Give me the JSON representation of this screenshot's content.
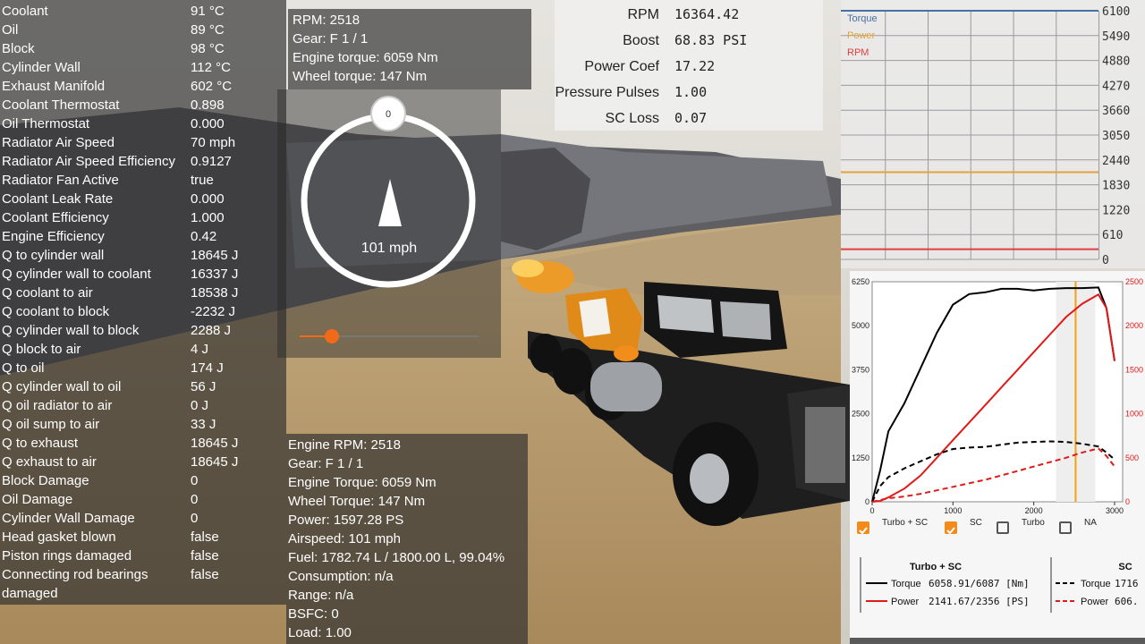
{
  "thermal": [
    {
      "label": "Coolant",
      "value": "91 °C"
    },
    {
      "label": "Oil",
      "value": "89 °C"
    },
    {
      "label": "Block",
      "value": "98 °C"
    },
    {
      "label": "Cylinder Wall",
      "value": "112 °C"
    },
    {
      "label": "Exhaust Manifold",
      "value": "602 °C"
    },
    {
      "label": "Coolant Thermostat",
      "value": "0.898"
    },
    {
      "label": "Oil Thermostat",
      "value": "0.000"
    },
    {
      "label": "Radiator Air Speed",
      "value": "70 mph"
    },
    {
      "label": "Radiator Air Speed Efficiency",
      "value": "0.9127"
    },
    {
      "label": "Radiator Fan Active",
      "value": "true"
    },
    {
      "label": "Coolant Leak Rate",
      "value": "0.000"
    },
    {
      "label": "Coolant Efficiency",
      "value": "1.000"
    },
    {
      "label": "Engine Efficiency",
      "value": "0.42"
    },
    {
      "label": "Q to cylinder wall",
      "value": "18645 J"
    },
    {
      "label": "Q cylinder wall to coolant",
      "value": "16337 J"
    },
    {
      "label": "Q coolant to air",
      "value": "18538 J"
    },
    {
      "label": "Q coolant to block",
      "value": "-2232 J"
    },
    {
      "label": "Q cylinder wall to block",
      "value": "2288 J"
    },
    {
      "label": "Q block to air",
      "value": "4 J"
    },
    {
      "label": "Q to oil",
      "value": "174 J"
    },
    {
      "label": "Q cylinder wall to oil",
      "value": "56 J"
    },
    {
      "label": "Q oil radiator to air",
      "value": "0 J"
    },
    {
      "label": "Q oil sump to air",
      "value": "33 J"
    },
    {
      "label": "Q to exhaust",
      "value": "18645 J"
    },
    {
      "label": "Q exhaust to air",
      "value": "18645 J"
    },
    {
      "label": "Block Damage",
      "value": "0"
    },
    {
      "label": "Oil Damage",
      "value": "0"
    },
    {
      "label": "Cylinder Wall Damage",
      "value": "0"
    },
    {
      "label": "Head gasket blown",
      "value": "false"
    },
    {
      "label": "Piston rings damaged",
      "value": "false"
    },
    {
      "label": "Connecting rod bearings",
      "value": "false"
    },
    {
      "label": "damaged",
      "value": ""
    }
  ],
  "top_info": {
    "rpm": "RPM: 2518",
    "gear": "Gear: F 1 / 1",
    "engine_torque": "Engine torque: 6059 Nm",
    "wheel_torque": "Wheel torque: 147 Nm"
  },
  "gauge": {
    "top_value": "0",
    "speed": "101 mph",
    "slider_fraction": 0.18
  },
  "engine_info": [
    "Engine RPM: 2518",
    "Gear: F 1 / 1",
    "Engine Torque: 6059 Nm",
    "Wheel Torque: 147 Nm",
    "Power: 1597.28 PS",
    "Airspeed: 101 mph",
    "Fuel: 1782.74 L / 1800.00 L, 99.04%",
    "Consumption: n/a",
    "Range: n/a",
    "BSFC: 0",
    "Load: 1.00"
  ],
  "engine_stats": [
    {
      "label": "RPM",
      "value": "16364.42"
    },
    {
      "label": "Boost",
      "value": "68.83 PSI"
    },
    {
      "label": "Power Coef",
      "value": "17.22"
    },
    {
      "label": "Pressure Pulses",
      "value": "1.00"
    },
    {
      "label": "SC Loss",
      "value": "0.07"
    }
  ],
  "live_graph": {
    "legend": [
      {
        "name": "Torque",
        "color": "#4a6fa5"
      },
      {
        "name": "Power",
        "color": "#e3a33a"
      },
      {
        "name": "RPM",
        "color": "#e04040"
      }
    ],
    "y_ticks": [
      "6100",
      "5490",
      "4880",
      "4270",
      "3660",
      "3050",
      "2440",
      "1830",
      "1220",
      "610",
      "0"
    ],
    "y_max": 6100,
    "series_levels": {
      "Torque": 6100,
      "Power": 2140,
      "RPM": 250
    }
  },
  "chart_data": {
    "type": "line",
    "x": [
      0,
      100,
      200,
      400,
      600,
      800,
      1000,
      1200,
      1400,
      1600,
      1800,
      2000,
      2200,
      2400,
      2600,
      2800,
      2900,
      3000
    ],
    "xlim": [
      0,
      3100
    ],
    "x_ticks": [
      "0",
      "1000",
      "2000",
      "3000"
    ],
    "y_left_ticks": [
      "0",
      "1250",
      "2500",
      "3750",
      "5000",
      "6250"
    ],
    "y_right_ticks": [
      "0",
      "500",
      "1000",
      "1500",
      "2000",
      "2500"
    ],
    "ylim_left": [
      0,
      6250
    ],
    "ylim_right": [
      0,
      2500
    ],
    "marker_rpm": 2518,
    "series": [
      {
        "name": "Torque",
        "group": "Turbo + SC",
        "axis": "left",
        "style": "solid",
        "color": "#000000",
        "values": [
          0,
          900,
          2000,
          2800,
          3800,
          4800,
          5600,
          5900,
          5950,
          6050,
          6050,
          6000,
          6050,
          6070,
          6070,
          6087,
          5500,
          4000
        ]
      },
      {
        "name": "Power",
        "group": "Turbo + SC",
        "axis": "right",
        "style": "solid",
        "color": "#e01a1a",
        "values": [
          0,
          10,
          50,
          150,
          300,
          500,
          700,
          900,
          1100,
          1300,
          1500,
          1700,
          1900,
          2100,
          2250,
          2356,
          2200,
          1600
        ]
      },
      {
        "name": "Torque",
        "group": "SC",
        "axis": "left",
        "style": "dashed",
        "color": "#000000",
        "values": [
          0,
          450,
          700,
          950,
          1150,
          1350,
          1500,
          1540,
          1560,
          1620,
          1680,
          1700,
          1716,
          1700,
          1650,
          1570,
          1400,
          1200
        ]
      },
      {
        "name": "Power",
        "group": "SC",
        "axis": "right",
        "style": "dashed",
        "color": "#e01a1a",
        "values": [
          0,
          20,
          40,
          60,
          90,
          130,
          170,
          210,
          250,
          300,
          350,
          400,
          450,
          500,
          560,
          606,
          520,
          400
        ]
      }
    ]
  },
  "dyno_checkboxes": [
    {
      "label": "Turbo + SC",
      "checked": true
    },
    {
      "label": "SC",
      "checked": true
    },
    {
      "label": "Turbo",
      "checked": false
    },
    {
      "label": "NA",
      "checked": false
    }
  ],
  "dyno_legend": {
    "group1": "Turbo + SC",
    "group2": "SC",
    "t1_label": "Torque",
    "t1_value": "6058.91/6087 [Nm]",
    "p1_label": "Power",
    "p1_value": "2141.67/2356 [PS]",
    "t2_label": "Torque",
    "t2_value": "1716",
    "p2_label": "Power",
    "p2_value": "606."
  }
}
